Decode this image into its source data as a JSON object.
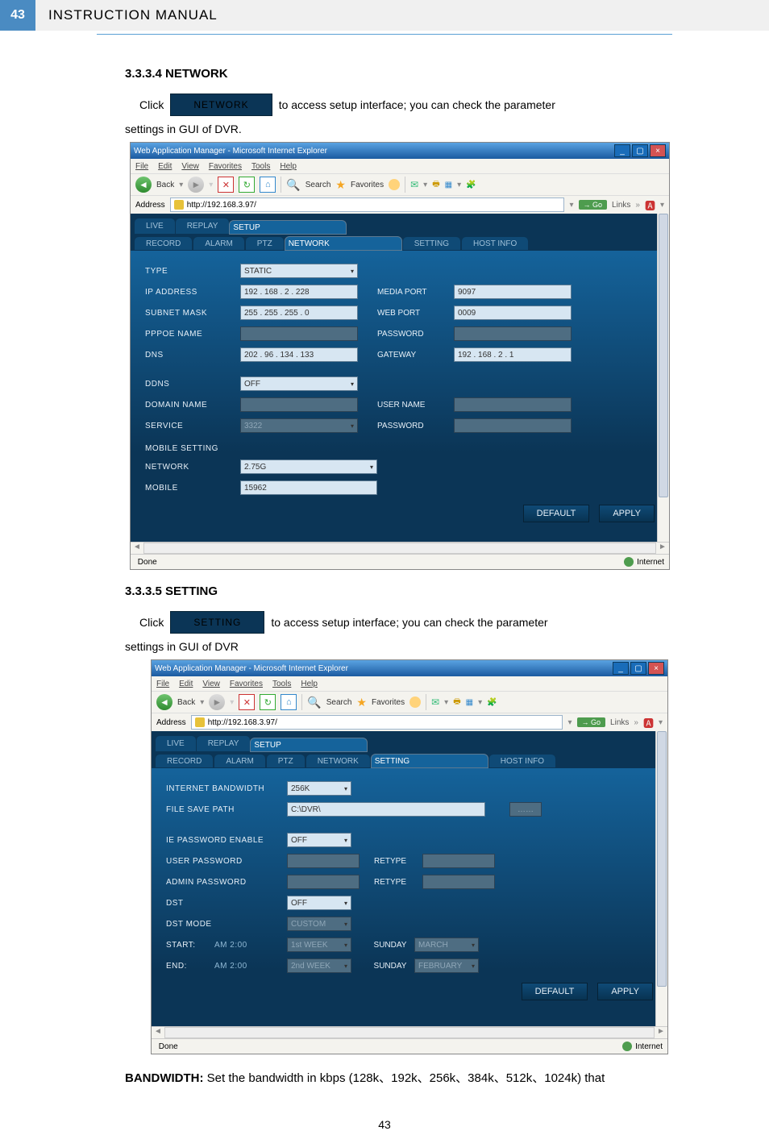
{
  "header": {
    "pagebox": "43",
    "title": "INSTRUCTION MANUAL"
  },
  "s1": {
    "title": "3.3.3.4 NETWORK",
    "click": "Click",
    "btn": "NETWORK",
    "rest": "to access setup interface; you can check the parameter",
    "line2": "settings in GUI of DVR."
  },
  "browser": {
    "title": "Web Application Manager - Microsoft Internet Explorer",
    "menu": [
      "File",
      "Edit",
      "View",
      "Favorites",
      "Tools",
      "Help"
    ],
    "toolbar": {
      "back": "Back",
      "search": "Search",
      "fav": "Favorites"
    },
    "addr_label": "Address",
    "addr_url": "http://192.168.3.97/",
    "go": "Go",
    "links": "Links",
    "done": "Done",
    "net": "Internet",
    "tabs": [
      "LIVE",
      "REPLAY",
      "SETUP"
    ],
    "subtabs": [
      "RECORD",
      "ALARM",
      "PTZ",
      "NETWORK",
      "SETTING",
      "HOST INFO"
    ]
  },
  "net": {
    "type_l": "TYPE",
    "type_v": "STATIC",
    "ip_l": "IP ADDRESS",
    "ip_v": "192 . 168 .  2  . 228",
    "sub_l": "SUBNET MASK",
    "sub_v": "255 . 255 . 255 .  0",
    "ppp_l": "PPPOE NAME",
    "dns_l": "DNS",
    "dns_v": "202 .  96  . 134 . 133",
    "media_l": "MEDIA PORT",
    "media_v": "9097",
    "web_l": "WEB PORT",
    "web_v": "0009",
    "pwd_l": "PASSWORD",
    "gw_l": "GATEWAY",
    "gw_v": "192 . 168 .  2  .  1",
    "ddns_l": "DDNS",
    "ddns_v": "OFF",
    "dom_l": "DOMAIN NAME",
    "usr_l": "USER NAME",
    "svc_l": "SERVICE",
    "svc_v": "3322",
    "pw2_l": "PASSWORD",
    "mob_l": "MOBILE SETTING",
    "nw_l": "NETWORK",
    "nw_v": "2.75G",
    "mobp_l": "MOBILE",
    "mobp_v": "15962",
    "default": "DEFAULT",
    "apply": "APPLY"
  },
  "s2": {
    "title": "3.3.3.5 SETTING",
    "click": "Click",
    "btn": "SETTING",
    "rest": "to access setup interface; you can check the parameter",
    "line2": "settings in GUI of DVR"
  },
  "set": {
    "bw_l": "INTERNET BANDWIDTH",
    "bw_v": "256K",
    "fsp_l": "FILE SAVE PATH",
    "fsp_v": "C:\\DVR\\",
    "dotdot": "……",
    "ie_l": "IE PASSWORD ENABLE",
    "ie_v": "OFF",
    "up_l": "USER PASSWORD",
    "re_l": "RETYPE",
    "ap_l": "ADMIN PASSWORD",
    "dst_l": "DST",
    "dst_v": "OFF",
    "dstm_l": "DST MODE",
    "dstm_v": "CUSTOM",
    "start_l": "START:",
    "start_t": "AM 2:00",
    "start_w": "1st WEEK",
    "start_d": "SUNDAY",
    "start_m": "MARCH",
    "end_l": "END:",
    "end_t": "AM 2:00",
    "end_w": "2nd WEEK",
    "end_d": "SUNDAY",
    "end_m": "FEBRUARY",
    "default": "DEFAULT",
    "apply": "APPLY"
  },
  "bw_line": {
    "b": "BANDWIDTH: ",
    "rest": "Set the bandwidth in kbps (128k、192k、256k、384k、512k、1024k) that"
  },
  "footer_page": "43"
}
